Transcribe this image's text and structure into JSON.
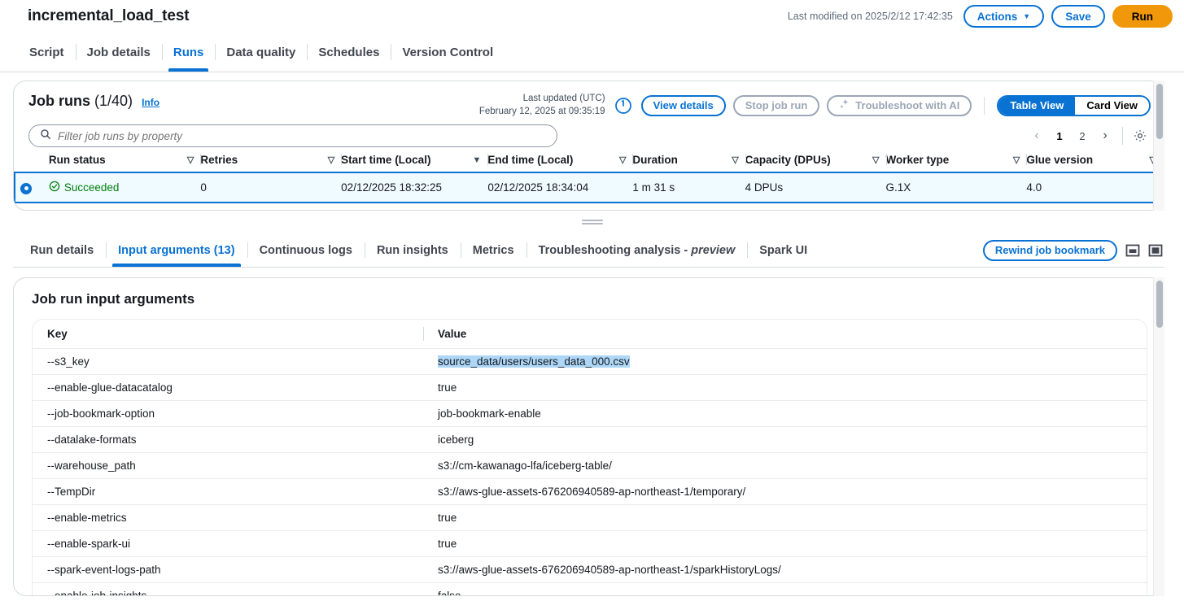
{
  "header": {
    "job_title": "incremental_load_test",
    "last_modified": "Last modified on 2025/2/12 17:42:35",
    "actions_label": "Actions",
    "save_label": "Save",
    "run_label": "Run"
  },
  "main_tabs": [
    {
      "label": "Script",
      "active": false
    },
    {
      "label": "Job details",
      "active": false
    },
    {
      "label": "Runs",
      "active": true
    },
    {
      "label": "Data quality",
      "active": false
    },
    {
      "label": "Schedules",
      "active": false
    },
    {
      "label": "Version Control",
      "active": false
    }
  ],
  "job_runs": {
    "title": "Job runs",
    "count": "(1/40)",
    "info_label": "Info",
    "updated_label": "Last updated (UTC)",
    "updated_time": "February 12, 2025 at 09:35:19",
    "view_details_label": "View details",
    "stop_job_run_label": "Stop job run",
    "troubleshoot_label": "Troubleshoot with AI",
    "table_view_label": "Table View",
    "card_view_label": "Card View",
    "filter_placeholder": "Filter job runs by property",
    "filter_value": "",
    "pagination": {
      "prev": "‹",
      "pages": [
        "1",
        "2"
      ],
      "current": "1",
      "next": "›"
    },
    "columns": [
      {
        "label": "Run status",
        "sorted": false
      },
      {
        "label": "Retries",
        "sorted": false
      },
      {
        "label": "Start time (Local)",
        "sorted": true
      },
      {
        "label": "End time (Local)",
        "sorted": false
      },
      {
        "label": "Duration",
        "sorted": false
      },
      {
        "label": "Capacity (DPUs)",
        "sorted": false
      },
      {
        "label": "Worker type",
        "sorted": false
      },
      {
        "label": "Glue version",
        "sorted": false
      }
    ],
    "rows": [
      {
        "selected": true,
        "status": "Succeeded",
        "retries": "0",
        "start_time": "02/12/2025 18:32:25",
        "end_time": "02/12/2025 18:34:04",
        "duration": "1 m 31 s",
        "capacity": "4 DPUs",
        "worker_type": "G.1X",
        "glue_version": "4.0"
      }
    ]
  },
  "sub_tabs": [
    {
      "label": "Run details",
      "active": false
    },
    {
      "label": "Input arguments (13)",
      "active": true
    },
    {
      "label": "Continuous logs",
      "active": false
    },
    {
      "label": "Run insights",
      "active": false
    },
    {
      "label": "Metrics",
      "active": false
    },
    {
      "label": "Troubleshooting analysis - preview",
      "active": false
    },
    {
      "label": "Spark UI",
      "active": false
    }
  ],
  "sub_tabs_right": {
    "rewind_label": "Rewind job bookmark"
  },
  "input_arguments": {
    "title": "Job run input arguments",
    "col_key": "Key",
    "col_value": "Value",
    "rows": [
      {
        "key": "--s3_key",
        "value": "source_data/users/users_data_000.csv",
        "selected": true
      },
      {
        "key": "--enable-glue-datacatalog",
        "value": "true",
        "selected": false
      },
      {
        "key": "--job-bookmark-option",
        "value": "job-bookmark-enable",
        "selected": false
      },
      {
        "key": "--datalake-formats",
        "value": "iceberg",
        "selected": false
      },
      {
        "key": "--warehouse_path",
        "value": "s3://cm-kawanago-lfa/iceberg-table/",
        "selected": false
      },
      {
        "key": "--TempDir",
        "value": "s3://aws-glue-assets-676206940589-ap-northeast-1/temporary/",
        "selected": false
      },
      {
        "key": "--enable-metrics",
        "value": "true",
        "selected": false
      },
      {
        "key": "--enable-spark-ui",
        "value": "true",
        "selected": false
      },
      {
        "key": "--spark-event-logs-path",
        "value": "s3://aws-glue-assets-676206940589-ap-northeast-1/sparkHistoryLogs/",
        "selected": false
      },
      {
        "key": "--enable-job-insights",
        "value": "false",
        "selected": false
      }
    ]
  },
  "colors": {
    "accent": "#0972d3",
    "run_button": "#f0980a",
    "success": "#037f0c",
    "selection": "#aed7f7"
  }
}
